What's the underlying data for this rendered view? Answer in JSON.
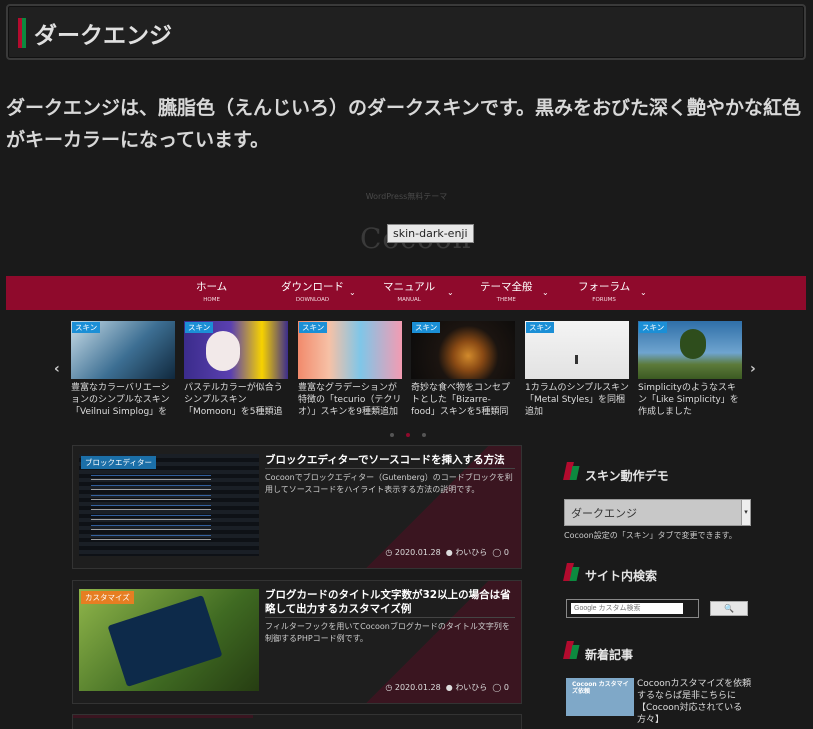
{
  "page": {
    "title": "ダークエンジ",
    "description": "ダークエンジは、臙脂色（えんじいろ）のダークスキンです。黒みをおびた深く艶やかな紅色がキーカラーになっています。"
  },
  "site": {
    "tagline": "WordPress無料テーマ",
    "logo": "Cocoon",
    "tooltip": "skin-dark-enji"
  },
  "nav": {
    "items": [
      {
        "label": "ホーム",
        "sub": "HOME"
      },
      {
        "label": "ダウンロード",
        "sub": "DOWNLOAD"
      },
      {
        "label": "マニュアル",
        "sub": "MANUAL"
      },
      {
        "label": "テーマ全般",
        "sub": "THEME"
      },
      {
        "label": "フォーラム",
        "sub": "FORUMS"
      }
    ]
  },
  "carousel": {
    "prev": "‹",
    "next": "›",
    "cards": [
      {
        "tag": "スキン",
        "title": "豊富なカラーバリエーションのシンプルなスキン「Veilnui Simplog」を"
      },
      {
        "tag": "スキン",
        "title": "パステルカラーが似合うシンプルスキン「Momoon」を5種類追"
      },
      {
        "tag": "スキン",
        "title": "豊富なグラデーションが特徴の「tecurio（テクリオ）」スキンを9種類追加"
      },
      {
        "tag": "スキン",
        "title": "奇妙な食べ物をコンセプトとした「Bizarre-food」スキンを5種類同"
      },
      {
        "tag": "スキン",
        "title": "1カラムのシンプルスキン「Metal Styles」を同梱追加"
      },
      {
        "tag": "スキン",
        "title": "Simplicityのようなスキン「Like Simplicity」を作成しました"
      }
    ]
  },
  "posts": [
    {
      "category": "ブロックエディター",
      "category_color": "#1b6fa8",
      "title": "ブロックエディターでソースコードを挿入する方法",
      "snippet": "Cocoonでブロックエディター（Gutenberg）のコードブロックを利用してソースコードをハイライト表示する方法の説明です。",
      "date": "2020.01.28",
      "author": "わいひら",
      "comments": "0"
    },
    {
      "category": "カスタマイズ",
      "category_color": "#e67e22",
      "title": "ブログカードのタイトル文字数が32以上の場合は省略して出力するカスタマイズ例",
      "snippet": "フィルターフックを用いてCocoonブログカードのタイトル文字列を制御するPHPコード例です。",
      "date": "2020.01.28",
      "author": "わいひら",
      "comments": "0"
    }
  ],
  "sidebar": {
    "skin_demo": {
      "heading": "スキン動作デモ",
      "selected": "ダークエンジ",
      "note": "Cocoon設定の「スキン」タブで変更できます。"
    },
    "search": {
      "heading": "サイト内検索",
      "placeholder": "Google カスタム検索",
      "button": "🔍"
    },
    "recent": {
      "heading": "新着記事",
      "thumb_label": "Cocoon カスタマイズ依頼",
      "title": "Cocoonカスタマイズを依頼するならば是非こちらに【Cocoon対応されている方々】"
    }
  },
  "colors": {
    "accent": "#8f0a2c",
    "tag_blue": "#1b8fd6",
    "bg": "#1a1a1a"
  }
}
